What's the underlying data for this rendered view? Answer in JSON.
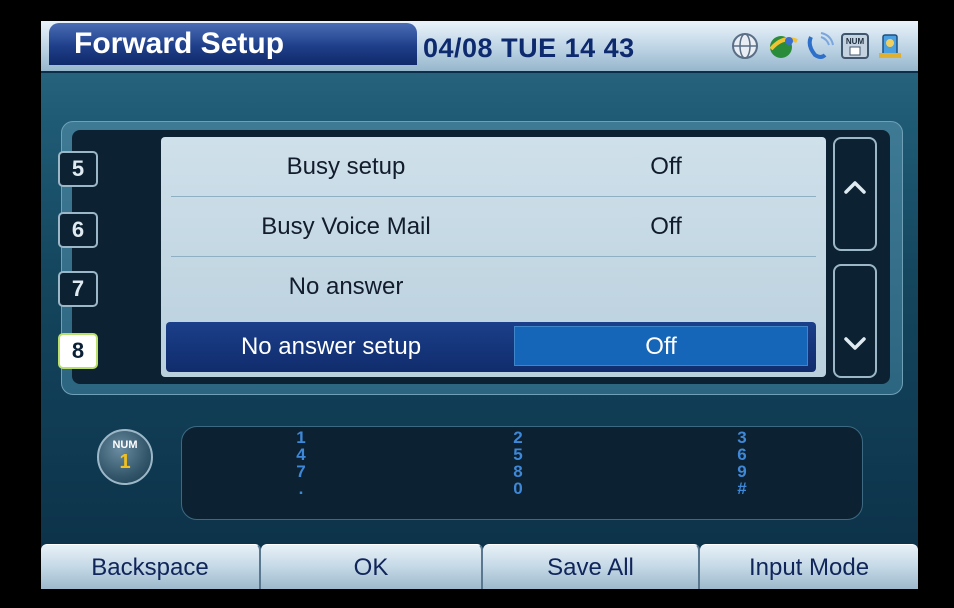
{
  "header": {
    "title": "Forward Setup",
    "date": "04/08",
    "day": "TUE",
    "time": "14 43",
    "icons": [
      "globe-icon",
      "network-icon",
      "phone-ring-icon",
      "num-mode-icon",
      "pc-user-icon"
    ]
  },
  "list": {
    "rows": [
      {
        "index": "5",
        "label": "Busy setup",
        "value": "Off"
      },
      {
        "index": "6",
        "label": "Busy Voice Mail",
        "value": "Off"
      },
      {
        "index": "7",
        "label": "No answer",
        "value": ""
      },
      {
        "index": "8",
        "label": "No answer setup",
        "value": "Off"
      }
    ],
    "selected_index": "8"
  },
  "input": {
    "mode_title": "NUM",
    "mode_number": "1",
    "keypad": {
      "col1": [
        "1",
        "4",
        "7",
        "."
      ],
      "col2": [
        "2",
        "5",
        "8",
        "0"
      ],
      "col3": [
        "3",
        "6",
        "9",
        "#"
      ]
    }
  },
  "softkeys": {
    "backspace": "Backspace",
    "ok": "OK",
    "save_all": "Save All",
    "input_mode": "Input Mode"
  },
  "colors": {
    "accent_blue": "#1b3f8a",
    "keypad_digits": "#3f88d8",
    "selection_outline": "#b8e06b"
  }
}
